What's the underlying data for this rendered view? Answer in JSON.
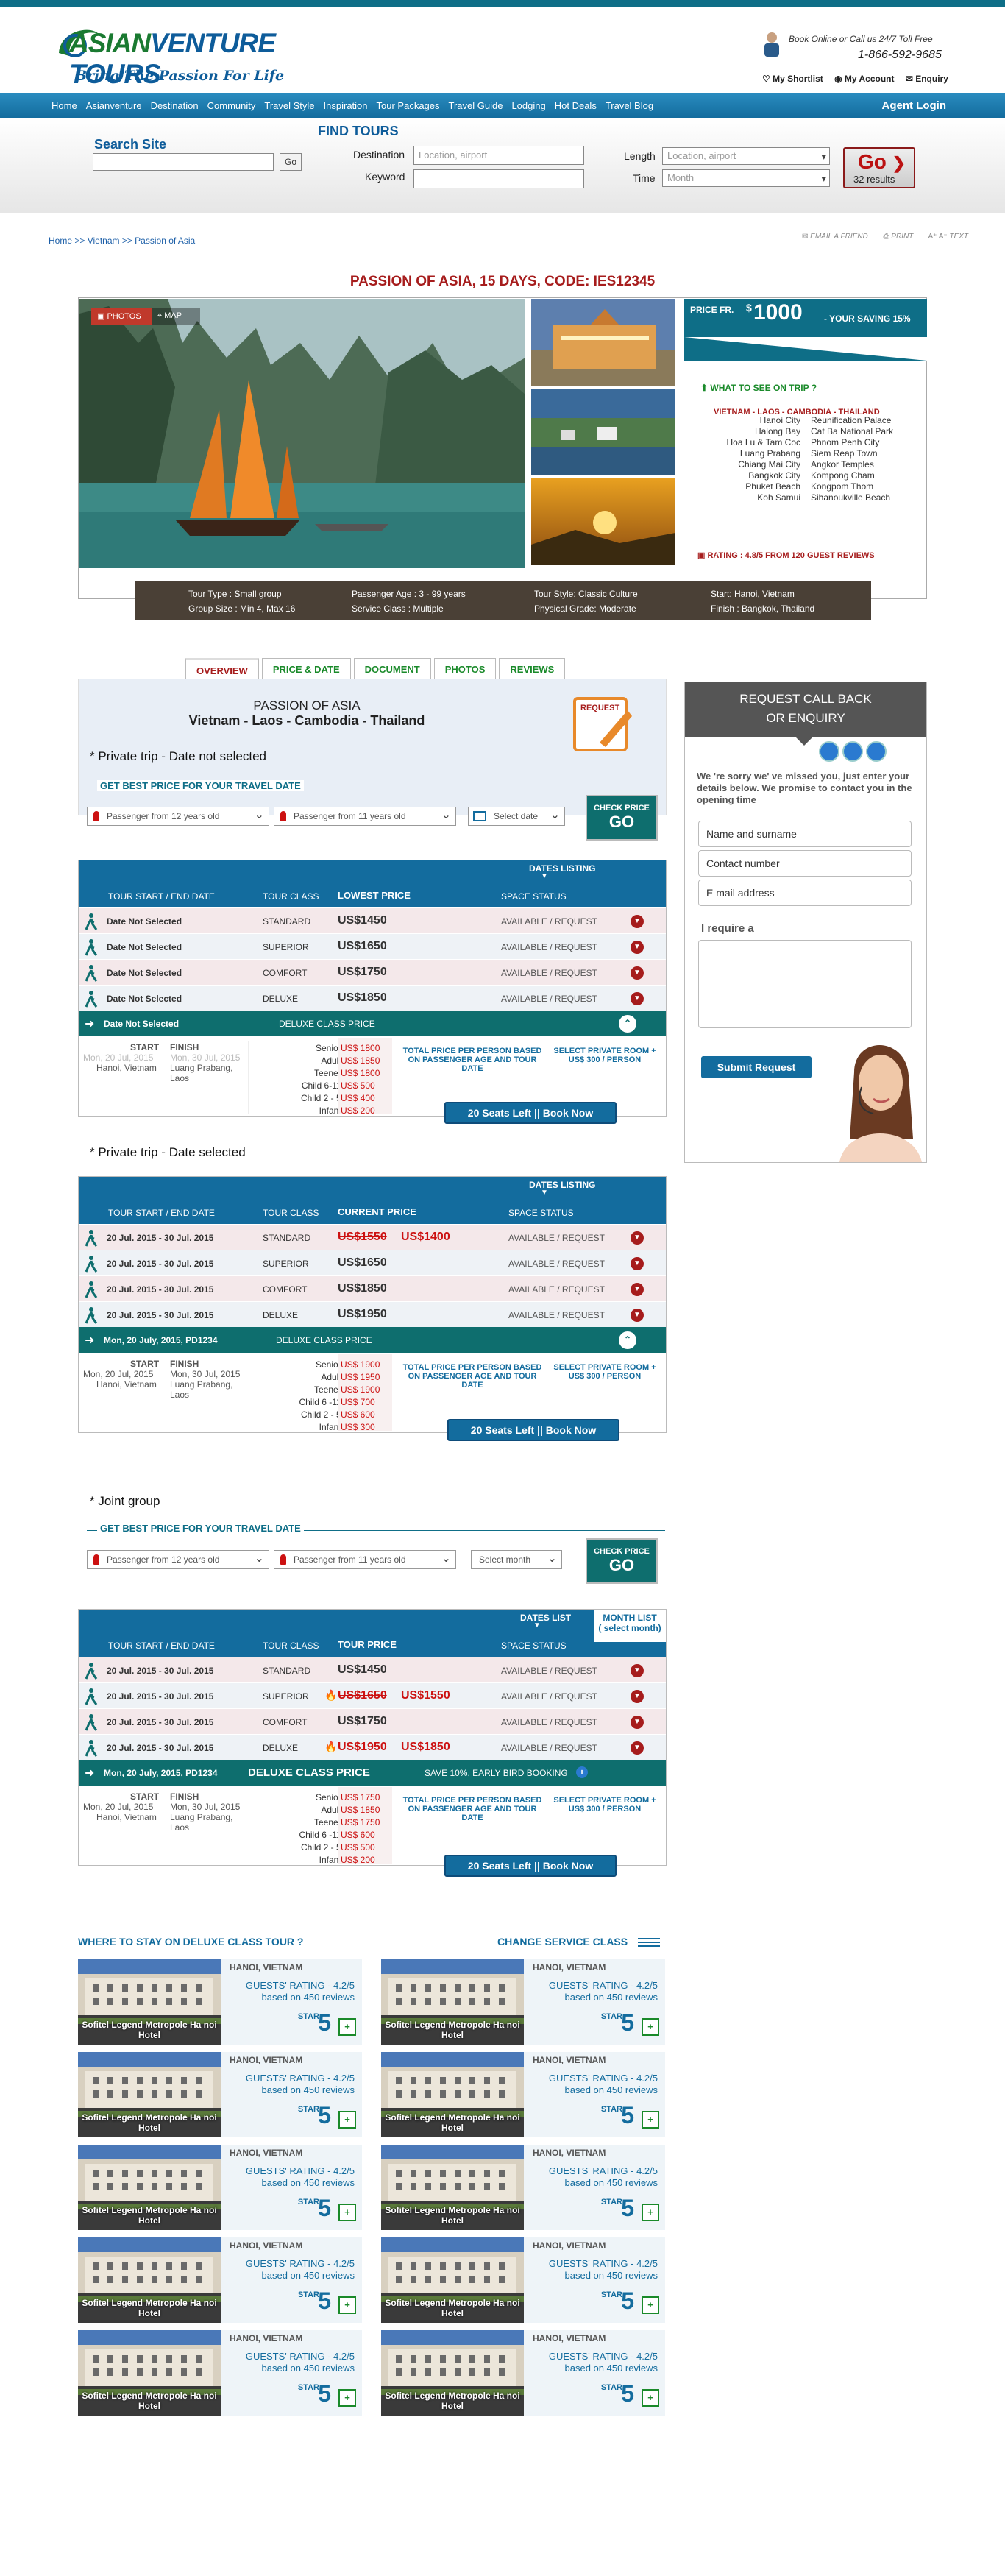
{
  "brand": {
    "name_part1": "ASIAN",
    "name_part2": "VENTURE TOURS",
    "tagline": "Bring The Passion For Life"
  },
  "contact": {
    "line1": "Book Online or Call us 24/7 Toll Free",
    "phone": "1-866-592-9685",
    "links": [
      "My Shortlist",
      "My Account",
      "Enquiry"
    ]
  },
  "nav": {
    "items": [
      "Home",
      "Asianventure",
      "Destination",
      "Community",
      "Travel Style",
      "Inspiration",
      "Tour Packages",
      "Travel Guide",
      "Lodging",
      "Hot Deals",
      "Travel Blog"
    ],
    "agent": "Agent Login"
  },
  "search": {
    "title": "Search Site",
    "go": "Go"
  },
  "find": {
    "title": "FIND TOURS",
    "destination_label": "Destination",
    "destination_ph": "Location, airport",
    "keyword_label": "Keyword",
    "length_label": "Length",
    "length_ph": "Location, airport",
    "time_label": "Time",
    "time_ph": "Month",
    "go": "Go",
    "results": "32  results"
  },
  "breadcrumb": "Home >>  Vietnam >> Passion of Asia",
  "tools": [
    "EMAIL A FRIEND",
    "PRINT",
    "TEXT"
  ],
  "tour": {
    "title": "PASSION OF ASIA, 15 DAYS, CODE: IES12345",
    "photos": "PHOTOS",
    "map": "MAP",
    "price_label": "PRICE FR.",
    "price_currency": "$",
    "price_amount": "1000",
    "saving": "- YOUR SAVING 15%",
    "see_title": "WHAT TO SEE ON TRIP ?",
    "route": "VIETNAM - LAOS - CAMBODIA - THAILAND",
    "places_left": [
      "Hanoi City",
      "Halong Bay",
      "Hoa Lu  & Tam Coc",
      "Luang Prabang",
      "Chiang Mai City",
      "Bangkok City",
      "Phuket Beach",
      "Koh Samui"
    ],
    "places_right": [
      "Reunification Palace",
      "Cat Ba National Park",
      "Phnom Penh City",
      "Siem Reap Town",
      "Angkor Temples",
      "Kompong Cham",
      "Kongpom Thom",
      "Sihanoukville Beach"
    ],
    "rating": "RATING : 4.8/5  FROM 120 GUEST REVIEWS",
    "info": {
      "type": "Tour Type : Small group",
      "size": "Group Size : Min 4, Max 16",
      "age": "Passenger Age : 3 - 99 years",
      "service": "Service Class :  Multiple",
      "style": "Tour Style: Classic Culture",
      "grade": "Physical Grade:  Moderate",
      "start": "Start: Hanoi, Vietnam",
      "finish": "Finish : Bangkok, Thailand"
    }
  },
  "tabs": [
    "OVERVIEW",
    "PRICE & DATE",
    "DOCUMENT",
    "PHOTOS",
    "REVIEWS"
  ],
  "overview": {
    "t1": "PASSION OF  ASIA",
    "t2": "Vietnam - Laos - Cambodia - Thailand",
    "request": "REQUEST"
  },
  "sec1": {
    "heading": "* Private trip - Date not selected",
    "bp": "GET  BEST  PRICE  FOR YOUR TRAVEL DATE",
    "p1": "Passenger from 12 years old",
    "p2": "Passenger from 11 years old",
    "date": "Select date",
    "chk_a": "CHECK PRICE",
    "chk_b": "GO",
    "hdr": {
      "dates": "DATES LISTING",
      "c1": "TOUR START / END DATE",
      "c2": "TOUR CLASS",
      "c3": "LOWEST  PRICE",
      "c4": "SPACE STATUS"
    },
    "rows": [
      {
        "date": "Date Not Selected",
        "cls": "STANDARD",
        "price": "US$1450",
        "status": "AVAILABLE / REQUEST"
      },
      {
        "date": "Date Not Selected",
        "cls": "SUPERIOR",
        "price": "US$1650",
        "status": "AVAILABLE / REQUEST"
      },
      {
        "date": "Date Not Selected",
        "cls": "COMFORT",
        "price": "US$1750",
        "status": "AVAILABLE / REQUEST"
      },
      {
        "date": "Date Not Selected",
        "cls": "DELUXE",
        "price": "US$1850",
        "status": "AVAILABLE / REQUEST"
      }
    ],
    "bar_left": "Date Not Selected",
    "bar_mid": "DELUXE CLASS  PRICE",
    "start": "START",
    "finish": "FINISH",
    "sdate": "Mon, 20 Jul, 2015",
    "fdate": "Mon, 30 Jul, 2015",
    "sloc": "Hanoi, Vietnam",
    "floc1": "Luang Prabang,",
    "floc2": "Laos",
    "ages": [
      "Senior:",
      "Adult:",
      "Teener:",
      "Child 6-11:",
      "Child 2 - 5:",
      "Infant:"
    ],
    "prices": [
      "US$ 1800",
      "US$ 1850",
      "US$ 1800",
      "US$ 500",
      "US$ 400",
      "US$ 200"
    ],
    "total": "TOTAL  PRICE  PER  PERSON BASED ON PASSENGER AGE AND TOUR DATE",
    "room": "SELECT PRIVATE ROOM + US$ 300 / PERSON",
    "book": "20 Seats Left  ||  Book Now"
  },
  "sec2": {
    "heading": "* Private trip - Date  selected",
    "hdr": {
      "dates": "DATES LISTING",
      "c1": "TOUR START / END DATE",
      "c2": "TOUR CLASS",
      "c3": "CURRENT PRICE",
      "c4": "SPACE STATUS"
    },
    "rows": [
      {
        "date": "20 Jul. 2015 - 30 Jul. 2015",
        "cls": "STANDARD",
        "old": "US$1550",
        "price": "US$1400",
        "status": "AVAILABLE / REQUEST"
      },
      {
        "date": "20 Jul. 2015 - 30 Jul. 2015",
        "cls": "SUPERIOR",
        "old": "",
        "price": "US$1650",
        "status": "AVAILABLE / REQUEST"
      },
      {
        "date": "20 Jul. 2015 - 30 Jul. 2015",
        "cls": "COMFORT",
        "old": "",
        "price": "US$1850",
        "status": "AVAILABLE / REQUEST"
      },
      {
        "date": "20 Jul. 2015 - 30 Jul. 2015",
        "cls": "DELUXE",
        "old": "",
        "price": "US$1950",
        "status": "AVAILABLE / REQUEST"
      }
    ],
    "bar_left": "Mon, 20 July, 2015, PD1234",
    "bar_mid": "DELUXE CLASS  PRICE",
    "prices": [
      "US$ 1900",
      "US$ 1950",
      "US$ 1900",
      "US$ 700",
      "US$ 600",
      "US$ 300"
    ],
    "ages": [
      "Senior:",
      "Adult:",
      "Teener:",
      "Child 6 -11:",
      "Child 2 - 5:",
      "Infant:"
    ]
  },
  "sec3": {
    "heading": "* Joint group",
    "month": "Select month",
    "hdr": {
      "dates": "DATES LIST",
      "month": "MONTH LIST",
      "month2": "( select month)",
      "c1": "TOUR START / END DATE",
      "c2": "TOUR CLASS",
      "c3": "TOUR PRICE",
      "c4": "SPACE STATUS"
    },
    "rows": [
      {
        "date": "20 Jul. 2015 - 30 Jul. 2015",
        "cls": "STANDARD",
        "old": "",
        "price": "US$1450",
        "status": "AVAILABLE / REQUEST"
      },
      {
        "date": "20 Jul. 2015 - 30 Jul. 2015",
        "cls": "SUPERIOR",
        "old": "US$1650",
        "price": "US$1550",
        "status": "AVAILABLE / REQUEST"
      },
      {
        "date": "20 Jul. 2015 - 30 Jul. 2015",
        "cls": "COMFORT",
        "old": "",
        "price": "US$1750",
        "status": "AVAILABLE / REQUEST"
      },
      {
        "date": "20 Jul. 2015 - 30 Jul. 2015",
        "cls": "DELUXE",
        "old": "US$1950",
        "price": "US$1850",
        "status": "AVAILABLE / REQUEST"
      }
    ],
    "bar_left": "Mon, 20 July, 2015, PD1234",
    "bar_mid": "DELUXE CLASS  PRICE",
    "bar_right": "SAVE 10%, EARLY BIRD BOOKING",
    "prices": [
      "US$ 1750",
      "US$ 1850",
      "US$ 1750",
      "US$ 600",
      "US$ 500",
      "US$ 200"
    ],
    "ages": [
      "Senior:",
      "Adult:",
      "Teener:",
      "Child 6 -11:",
      "Child 2 - 5:",
      "Infant:"
    ]
  },
  "sidebar": {
    "title1": "REQUEST CALL BACK",
    "title2": "OR ENQUIRY",
    "msg": "We 're sorry we' ve missed you, just enter your details below. We promise to contact you  in the opening time",
    "name": "Name and surname",
    "phone": "Contact number",
    "email": "E mail address",
    "require": "I require a",
    "submit": "Submit Request"
  },
  "stay": {
    "title": "WHERE TO STAY ON  DELUXE CLASS TOUR ?",
    "change": "CHANGE SERVICE  CLASS",
    "hotel": {
      "name": "Sofitel Legend Metropole Ha noi Hotel",
      "loc": "HANOI, VIETNAM",
      "rating": "GUESTS' RATING  - 4.2/5",
      "reviews": "based on 450 reviews",
      "star": "STAR",
      "stars": "5"
    }
  },
  "colors": {
    "teal": "#0e6e87",
    "blue": "#136c9e",
    "red": "#a61c1c",
    "green": "#1a8a2a"
  }
}
